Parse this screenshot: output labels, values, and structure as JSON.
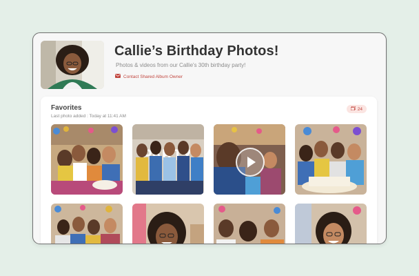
{
  "album": {
    "title": "Callie’s Birthday Photos!",
    "subtitle": "Photos & videos from our Callie's 30th birthday party!",
    "contact_label": "Contact Shared Album Owner",
    "owner_avatar_icon": "profile-photo"
  },
  "favorites": {
    "title": "Favorites",
    "last_added": "Last photo added : Today at 11:41 AM",
    "count": "24",
    "count_icon": "photos-icon"
  },
  "photos": [
    {
      "kind": "photo",
      "subject": "group celebration with cake"
    },
    {
      "kind": "photo",
      "subject": "group in front of party letters"
    },
    {
      "kind": "video",
      "subject": "party video",
      "play_icon": "play-icon"
    },
    {
      "kind": "photo",
      "subject": "group with birthday cake"
    },
    {
      "kind": "photo",
      "subject": "group of friends"
    },
    {
      "kind": "photo",
      "subject": "woman laughing"
    },
    {
      "kind": "photo",
      "subject": "group of friends smiling"
    },
    {
      "kind": "photo",
      "subject": "woman with glasses laughing"
    }
  ],
  "colors": {
    "accent": "#c1463f",
    "background": "#e4efe8"
  }
}
